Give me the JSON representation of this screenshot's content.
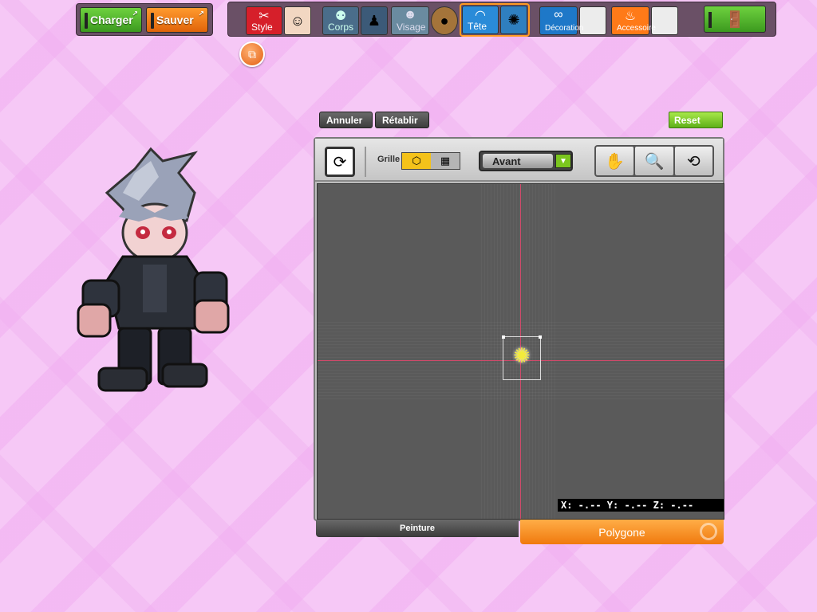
{
  "file_bar": {
    "load_label": "Charger",
    "save_label": "Sauver"
  },
  "categories": [
    {
      "label": "Style",
      "icon": "style-icon"
    },
    {
      "label": "Corps",
      "icon": "body-icon"
    },
    {
      "label": "Visage",
      "icon": "face-icon"
    },
    {
      "label": "Tête",
      "icon": "head-icon",
      "selected": true
    },
    {
      "label": "Décoration",
      "icon": "glasses-icon"
    },
    {
      "label": "Accessoire",
      "icon": "accessory-icon"
    }
  ],
  "exit": {
    "icon": "exit-door-icon"
  },
  "history": {
    "undo_label": "Annuler",
    "redo_label": "Rétablir",
    "reset_label": "Reset"
  },
  "editor": {
    "grid_label": "Grille",
    "view_selected": "Avant",
    "coords_text": "X: -.-- Y: -.-- Z: -.--"
  },
  "modes": {
    "paint_label": "Peinture",
    "polygon_label": "Polygone",
    "active": "Polygone"
  },
  "colors": {
    "accent_orange": "#f07a0e",
    "accent_green": "#5fb018",
    "background": "#f6c8f6"
  }
}
